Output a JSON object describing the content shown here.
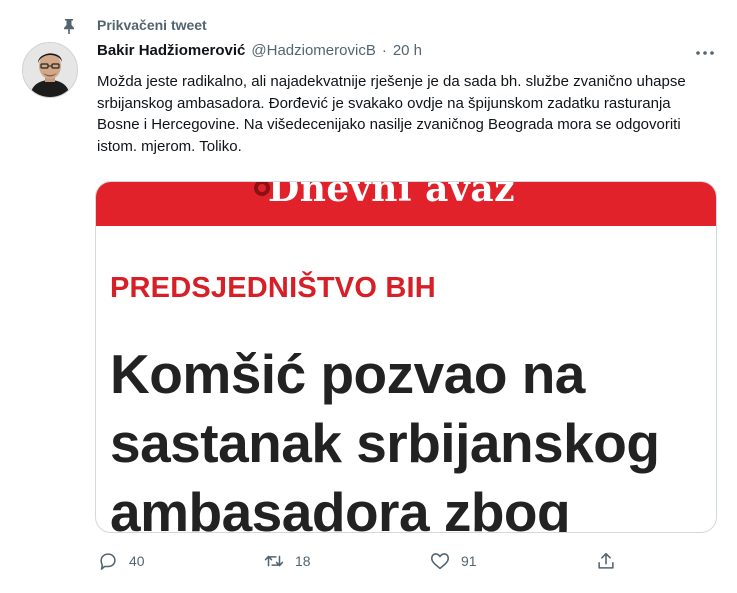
{
  "pinned": {
    "label": "Prikvačeni tweet"
  },
  "tweet": {
    "author_name": "Bakir Hadžiomerović",
    "handle": "@HadziomerovicB",
    "separator": "·",
    "time": "20 h",
    "text": "Možda jeste radikalno, ali najadekvatnije rješenje je da sada bh. službe zvanično uhapse srbijanskog ambasadora. Đorđević je svakako ovdje na špijunskom zadatku rasturanja Bosne i Hercegovine. Na višedecenijako nasilje zvaničnog Beograda mora se odgovoriti istom. mjerom. Toliko."
  },
  "card": {
    "masthead": "Dnevni avaz",
    "kicker": "PREDSJEDNIŠTVO BIH",
    "headline": "Komšić pozvao na sastanak srbijanskog ambasadora zbog"
  },
  "actions": {
    "replies": "40",
    "retweets": "18",
    "likes": "91"
  },
  "icons": {
    "pin": "pin-icon",
    "more": "more-icon",
    "reply": "reply-icon",
    "retweet": "retweet-icon",
    "like": "heart-icon",
    "share": "share-icon"
  },
  "colors": {
    "brand_red": "#e2222a",
    "kicker_red": "#d61f26",
    "secondary_text": "#536471"
  }
}
